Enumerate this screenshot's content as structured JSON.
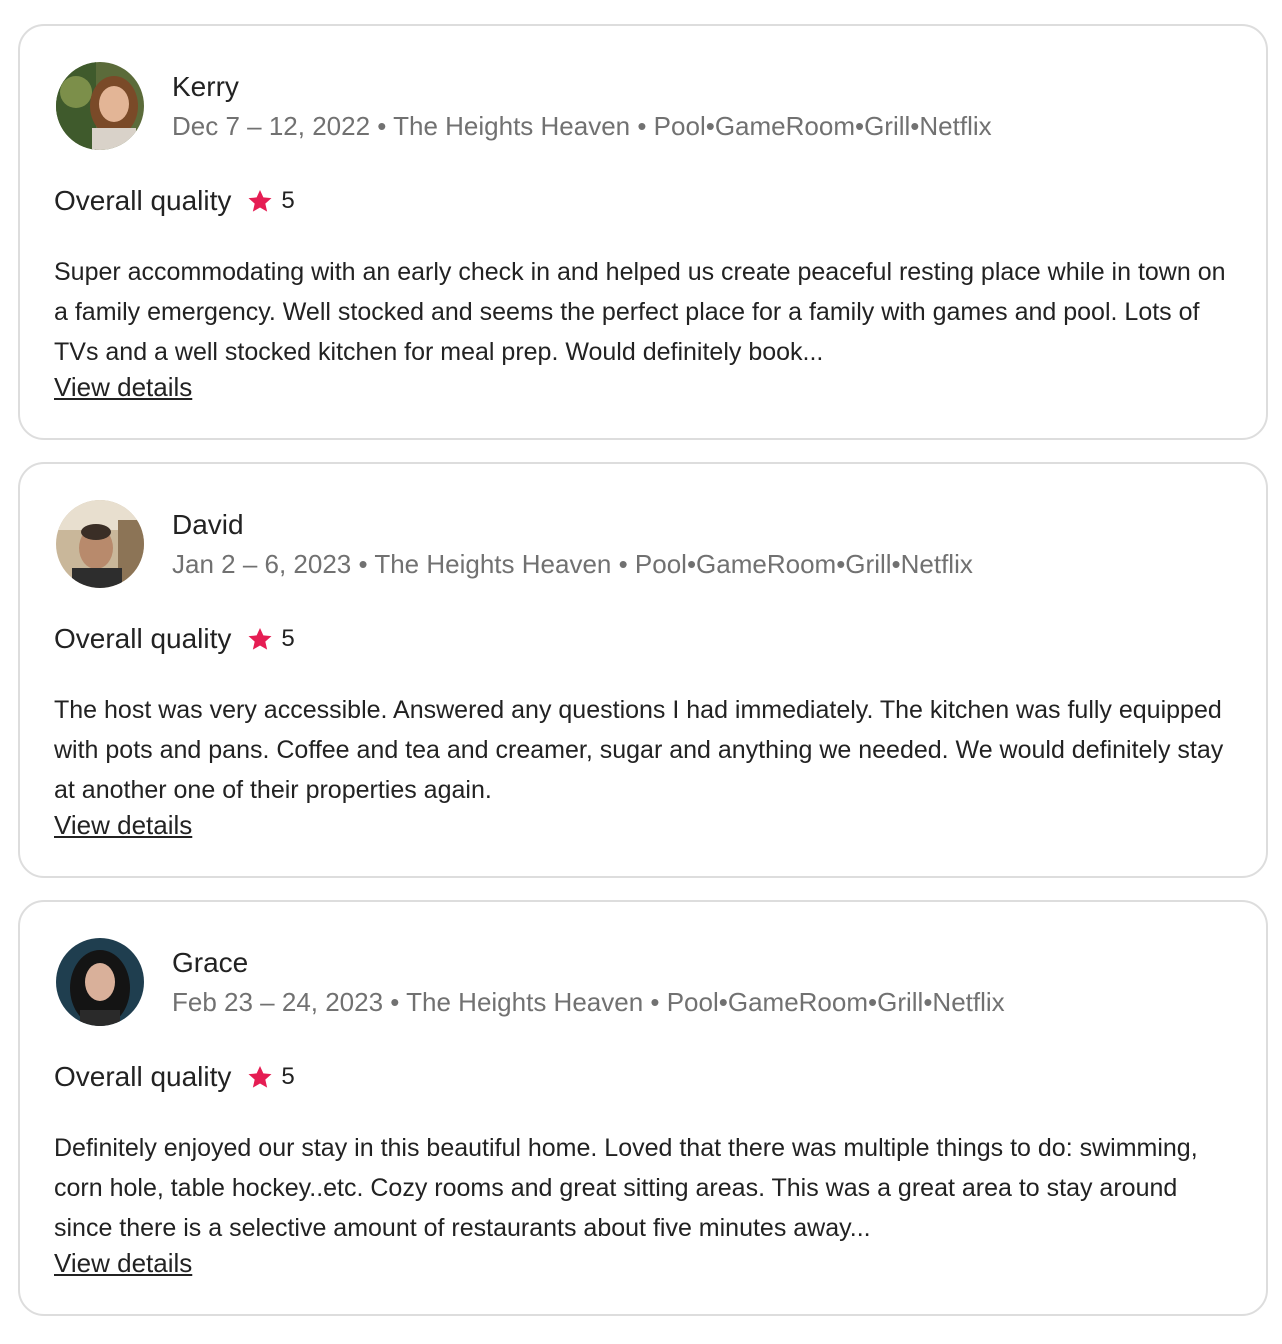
{
  "colors": {
    "star": "#e51d53",
    "meta_text": "#717171",
    "border": "#dddddd",
    "text": "#222222"
  },
  "reviews": [
    {
      "name": "Kerry",
      "meta": "Dec 7 – 12, 2022 • The Heights Heaven • Pool•GameRoom•Grill•Netflix",
      "rating_label": "Overall quality",
      "rating_icon": "star-icon",
      "rating_value": "5",
      "text": "Super accommodating with an early check in and helped us create peaceful resting place while in town on a family emergency. Well stocked and seems the perfect place for a family with games and pool. Lots of TVs and a well stocked kitchen for meal prep. Would definitely book...",
      "link_label": "View details"
    },
    {
      "name": "David",
      "meta": "Jan 2 – 6, 2023 • The Heights Heaven • Pool•GameRoom•Grill•Netflix",
      "rating_label": "Overall quality",
      "rating_icon": "star-icon",
      "rating_value": "5",
      "text": "The host was very accessible. Answered any questions I had immediately. The kitchen was fully equipped with pots and pans. Coffee and tea and creamer, sugar and anything we needed. We would definitely stay at another one of their properties again.",
      "link_label": "View details"
    },
    {
      "name": "Grace",
      "meta": "Feb 23 – 24, 2023 • The Heights Heaven • Pool•GameRoom•Grill•Netflix",
      "rating_label": "Overall quality",
      "rating_icon": "star-icon",
      "rating_value": "5",
      "text": "Definitely enjoyed our stay in this beautiful home. Loved that there was multiple things to do: swimming, corn hole, table hockey..etc. Cozy rooms and great sitting areas. This was a great area to stay around since there is a selective amount of restaurants about five minutes away...",
      "link_label": "View details"
    }
  ]
}
